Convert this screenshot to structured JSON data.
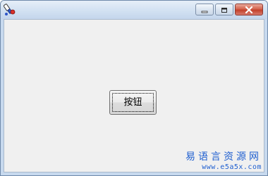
{
  "window": {
    "app_icon": "app-icon",
    "controls": {
      "minimize_icon": "minimize-icon",
      "maximize_icon": "maximize-icon",
      "close_icon": "close-icon"
    }
  },
  "form": {
    "button_label": "按钮"
  },
  "watermark": {
    "title": "易语言资源网",
    "url": "www.e5a5x.com"
  },
  "colors": {
    "titlebar": "#d2e1f2",
    "client_bg": "#f0f0f0",
    "close_button": "#c2412b",
    "watermark_text": "#1f5fd0"
  }
}
